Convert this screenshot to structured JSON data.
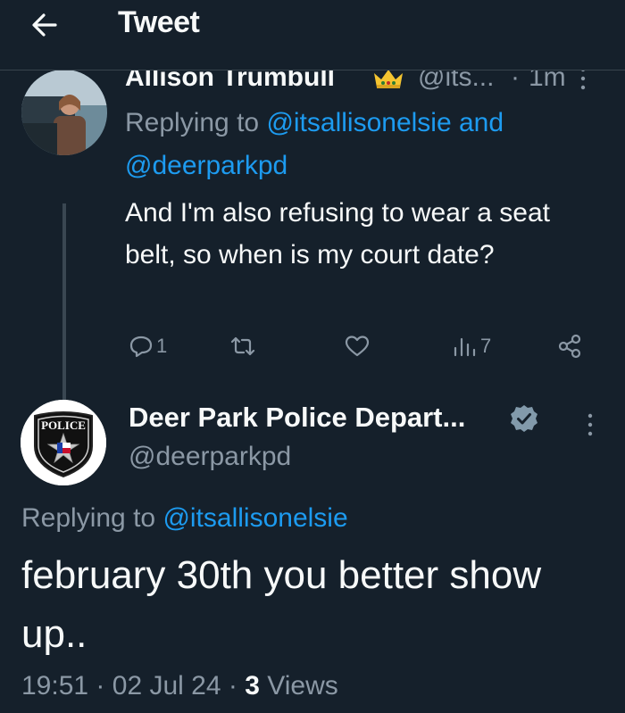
{
  "header": {
    "title": "Tweet"
  },
  "reply_tweet": {
    "author_name": "Allison Trumbull",
    "handle": "@its...",
    "separator": "·",
    "time": "1m",
    "replying_prefix": "Replying to",
    "replying_to_1": "@itsallisonelsie",
    "replying_and": "and",
    "replying_to_2": "@deerparkpd",
    "text": "And I'm also refusing to wear a seat belt, so when is my court date?",
    "replies_count": "1",
    "views_count": "7"
  },
  "main_tweet": {
    "author_name": "Deer Park Police Depart...",
    "handle": "@deerparkpd",
    "badge_text": "POLICE",
    "replying_prefix": "Replying to",
    "replying_to": "@itsallisonelsie",
    "text": "february 30th you better show up..",
    "time": "19:51",
    "date": "02 Jul 24",
    "sep": "·",
    "views_count": "3",
    "views_label": "Views"
  },
  "colors": {
    "background": "#15202b",
    "link": "#1d9bf0",
    "muted": "#8b98a5",
    "text": "#f7f9f9"
  },
  "icons": [
    "back-arrow-icon",
    "crown-icon",
    "more-icon",
    "reply-icon",
    "retweet-icon",
    "like-icon",
    "views-icon",
    "share-icon",
    "verified-icon",
    "police-badge-icon"
  ]
}
